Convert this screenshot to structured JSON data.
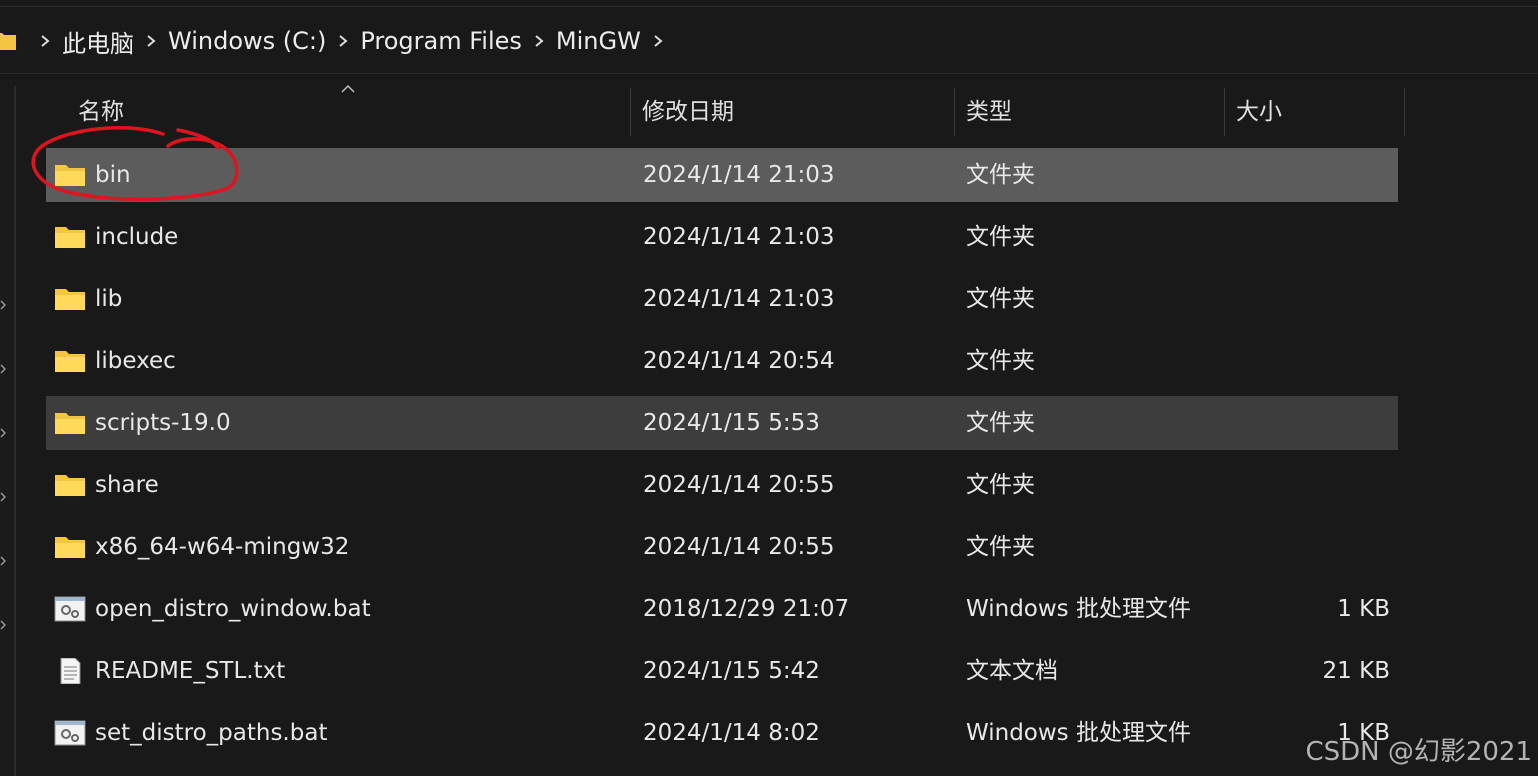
{
  "breadcrumb": {
    "items": [
      "此电脑",
      "Windows (C:)",
      "Program Files",
      "MinGW"
    ]
  },
  "columns": {
    "name": "名称",
    "date": "修改日期",
    "type": "类型",
    "size": "大小"
  },
  "files": [
    {
      "name": "bin",
      "date": "2024/1/14 21:03",
      "type": "文件夹",
      "size": "",
      "icon": "folder-icon",
      "state": "selected"
    },
    {
      "name": "include",
      "date": "2024/1/14 21:03",
      "type": "文件夹",
      "size": "",
      "icon": "folder-icon",
      "state": ""
    },
    {
      "name": "lib",
      "date": "2024/1/14 21:03",
      "type": "文件夹",
      "size": "",
      "icon": "folder-icon",
      "state": ""
    },
    {
      "name": "libexec",
      "date": "2024/1/14 20:54",
      "type": "文件夹",
      "size": "",
      "icon": "folder-icon",
      "state": ""
    },
    {
      "name": "scripts-19.0",
      "date": "2024/1/15 5:53",
      "type": "文件夹",
      "size": "",
      "icon": "folder-icon",
      "state": "hover"
    },
    {
      "name": "share",
      "date": "2024/1/14 20:55",
      "type": "文件夹",
      "size": "",
      "icon": "folder-icon",
      "state": ""
    },
    {
      "name": "x86_64-w64-mingw32",
      "date": "2024/1/14 20:55",
      "type": "文件夹",
      "size": "",
      "icon": "folder-icon",
      "state": ""
    },
    {
      "name": "open_distro_window.bat",
      "date": "2018/12/29 21:07",
      "type": "Windows 批处理文件",
      "size": "1 KB",
      "icon": "batch-file-icon",
      "state": ""
    },
    {
      "name": "README_STL.txt",
      "date": "2024/1/15 5:42",
      "type": "文本文档",
      "size": "21 KB",
      "icon": "text-file-icon",
      "state": ""
    },
    {
      "name": "set_distro_paths.bat",
      "date": "2024/1/14 8:02",
      "type": "Windows 批处理文件",
      "size": "1 KB",
      "icon": "batch-file-icon",
      "state": ""
    }
  ],
  "watermark": "CSDN @幻影2021",
  "colors": {
    "background": "#191919",
    "selected_row": "#5c5c5c",
    "hover_row": "#3d3d3d",
    "folder": "#f4c542",
    "annotation": "#e0141e"
  }
}
